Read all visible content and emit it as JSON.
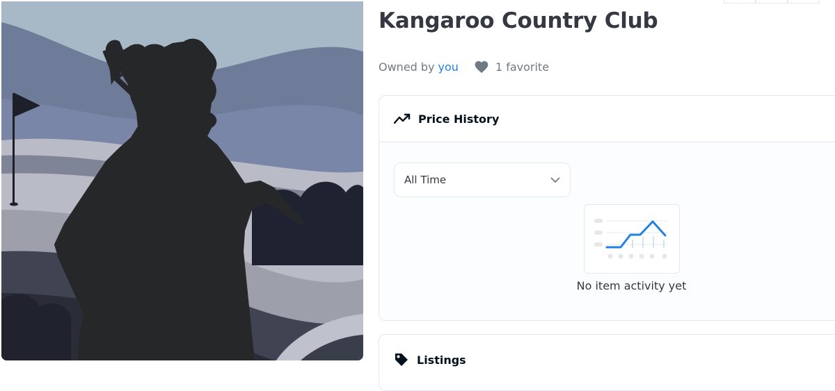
{
  "item": {
    "title": "Kangaroo Country Club",
    "owned_by_label": "Owned by",
    "owner": "you",
    "favorites": "1 favorite"
  },
  "price_history": {
    "header": "Price History",
    "range_selected": "All Time",
    "empty_message": "No item activity yet"
  },
  "listings": {
    "header": "Listings"
  },
  "icons": {
    "heart": "heart-icon",
    "trend": "trend-line-icon",
    "chevron": "chevron-down-icon",
    "tag": "tag-icon"
  },
  "colors": {
    "link": "#2081e2",
    "text": "#353840",
    "muted": "#707a83",
    "border": "#e5e8eb",
    "chart_accent": "#2081e2"
  }
}
